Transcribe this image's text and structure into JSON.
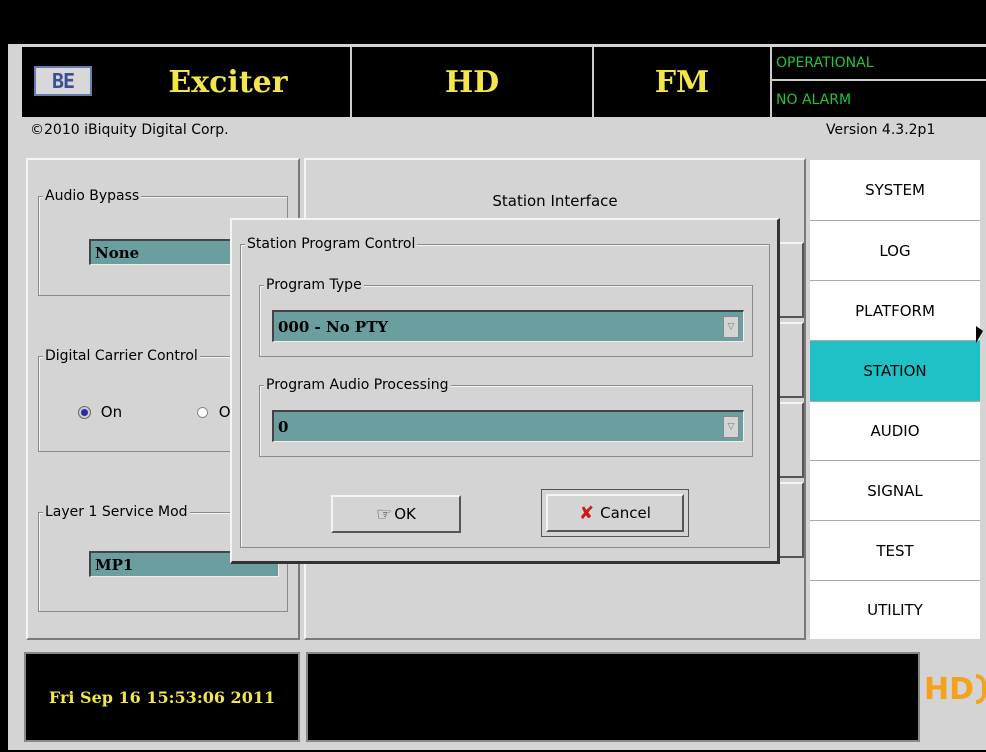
{
  "header": {
    "logo_text": "BE",
    "title": "Exciter",
    "mode1": "HD",
    "mode2": "FM",
    "status1": "OPERATIONAL",
    "status2": "NO ALARM"
  },
  "copyright": "©2010 iBiquity Digital Corp.",
  "version": "Version 4.3.2p1",
  "left": {
    "audio_bypass": {
      "label": "Audio Bypass",
      "value": "None"
    },
    "digital_carrier": {
      "label": "Digital Carrier Control",
      "option_on": "On",
      "option_off": "O"
    },
    "layer1": {
      "label": "Layer 1 Service Mod",
      "value": "MP1"
    }
  },
  "station_interface_label": "Station Interface",
  "dialog": {
    "title": "Station Program Control",
    "program_type": {
      "label": "Program Type",
      "value": "000 - No PTY"
    },
    "audio_processing": {
      "label": "Program Audio Processing",
      "value": "0"
    },
    "ok_label": "OK",
    "cancel_label": "Cancel"
  },
  "nav": {
    "items": [
      {
        "label": "SYSTEM"
      },
      {
        "label": "LOG"
      },
      {
        "label": "PLATFORM"
      },
      {
        "label": "STATION"
      },
      {
        "label": "AUDIO"
      },
      {
        "label": "SIGNAL"
      },
      {
        "label": "TEST"
      },
      {
        "label": "UTILITY"
      }
    ],
    "active": "STATION"
  },
  "footer": {
    "datetime": "Fri Sep 16 15:53:06 2011",
    "logo_text": "HD"
  },
  "colors": {
    "title_yellow": "#f2e64a",
    "status_green": "#25c23a",
    "nav_active": "#1fc1c6",
    "field_teal": "#6b9e9e"
  }
}
